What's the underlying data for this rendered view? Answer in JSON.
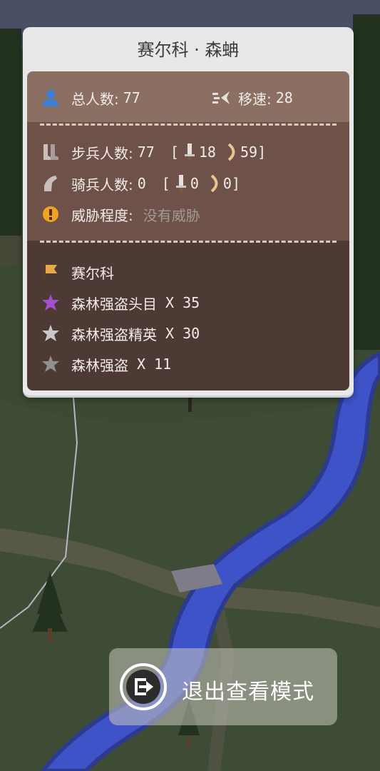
{
  "panel": {
    "title": "赛尔科 · 森蚺",
    "total_label": "总人数:",
    "total_value": "77",
    "speed_label": "移速:",
    "speed_value": "28",
    "infantry_label": "步兵人数:",
    "infantry_value": "77",
    "infantry_melee": "18",
    "infantry_ranged": "59",
    "cavalry_label": "骑兵人数:",
    "cavalry_value": "0",
    "cavalry_melee": "0",
    "cavalry_ranged": "0",
    "threat_label": "威胁程度:",
    "threat_value": "没有威胁",
    "bracket_open": "[",
    "bracket_close": "]",
    "faction": "赛尔科",
    "units": [
      {
        "name": "森林强盗头目",
        "count": "X 35",
        "star_color": "#a24fd0"
      },
      {
        "name": "森林强盗精英",
        "count": "X 30",
        "star_color": "#c9c9c9"
      },
      {
        "name": "森林强盗",
        "count": "X 11",
        "star_color": "#8f8f8f"
      }
    ]
  },
  "exit_button": {
    "label": "退出查看模式"
  },
  "colors": {
    "river": "#3f53c9",
    "grass": "#3c4a34",
    "panel_top": "#8b6f63",
    "panel_mid": "#6e524a",
    "panel_bottom": "#4e3a35"
  }
}
